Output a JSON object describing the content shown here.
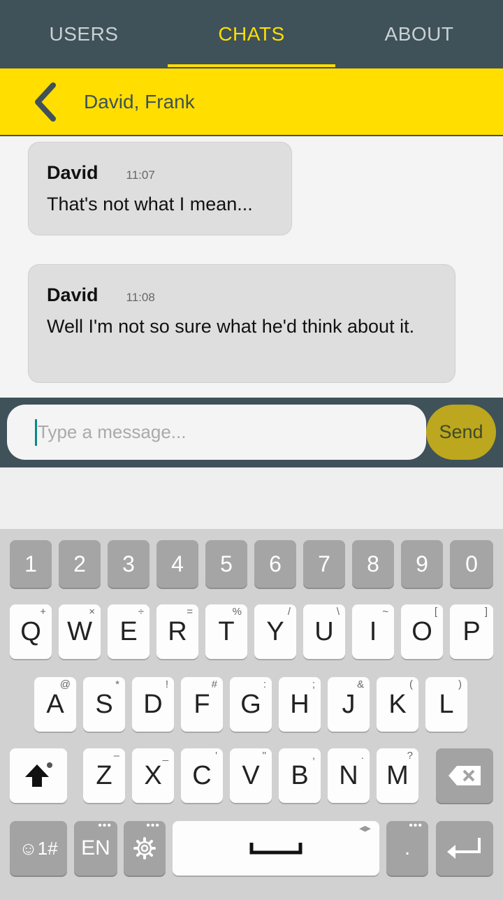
{
  "tabs": [
    {
      "label": "USERS",
      "active": false
    },
    {
      "label": "CHATS",
      "active": true
    },
    {
      "label": "ABOUT",
      "active": false
    }
  ],
  "chat": {
    "title": "David, Frank"
  },
  "messages": [
    {
      "sender": "David",
      "time": "11:07",
      "text": "That's not what I mean..."
    },
    {
      "sender": "David",
      "time": "11:08",
      "text": "Well I'm not so sure what he'd think about it."
    }
  ],
  "composer": {
    "placeholder": "Type a message...",
    "send_label": "Send"
  },
  "keyboard": {
    "numbers": [
      "1",
      "2",
      "3",
      "4",
      "5",
      "6",
      "7",
      "8",
      "9",
      "0"
    ],
    "row1": [
      {
        "key": "Q",
        "sec": "+"
      },
      {
        "key": "W",
        "sec": "×"
      },
      {
        "key": "E",
        "sec": "÷"
      },
      {
        "key": "R",
        "sec": "="
      },
      {
        "key": "T",
        "sec": "%"
      },
      {
        "key": "Y",
        "sec": "/"
      },
      {
        "key": "U",
        "sec": "\\"
      },
      {
        "key": "I",
        "sec": "~"
      },
      {
        "key": "O",
        "sec": "["
      },
      {
        "key": "P",
        "sec": "]"
      }
    ],
    "row2": [
      {
        "key": "A",
        "sec": "@"
      },
      {
        "key": "S",
        "sec": "*"
      },
      {
        "key": "D",
        "sec": "!"
      },
      {
        "key": "F",
        "sec": "#"
      },
      {
        "key": "G",
        "sec": ":"
      },
      {
        "key": "H",
        "sec": ";"
      },
      {
        "key": "J",
        "sec": "&"
      },
      {
        "key": "K",
        "sec": "("
      },
      {
        "key": "L",
        "sec": ")"
      }
    ],
    "row3": [
      {
        "key": "Z",
        "sec": "–"
      },
      {
        "key": "X",
        "sec": "_"
      },
      {
        "key": "C",
        "sec": "'"
      },
      {
        "key": "V",
        "sec": "\""
      },
      {
        "key": "B",
        "sec": ","
      },
      {
        "key": "N",
        "sec": "."
      },
      {
        "key": "M",
        "sec": "?"
      }
    ],
    "symbols_label": "☺1#",
    "lang_label": "EN",
    "period_label": ".",
    "icons": {
      "shift": "shift-icon",
      "backspace": "backspace-icon",
      "settings": "gear-icon",
      "space": "space-icon",
      "enter": "enter-icon"
    }
  },
  "colors": {
    "header_bg": "#3f5159",
    "accent": "#ffde00",
    "send": "#bca71e"
  }
}
